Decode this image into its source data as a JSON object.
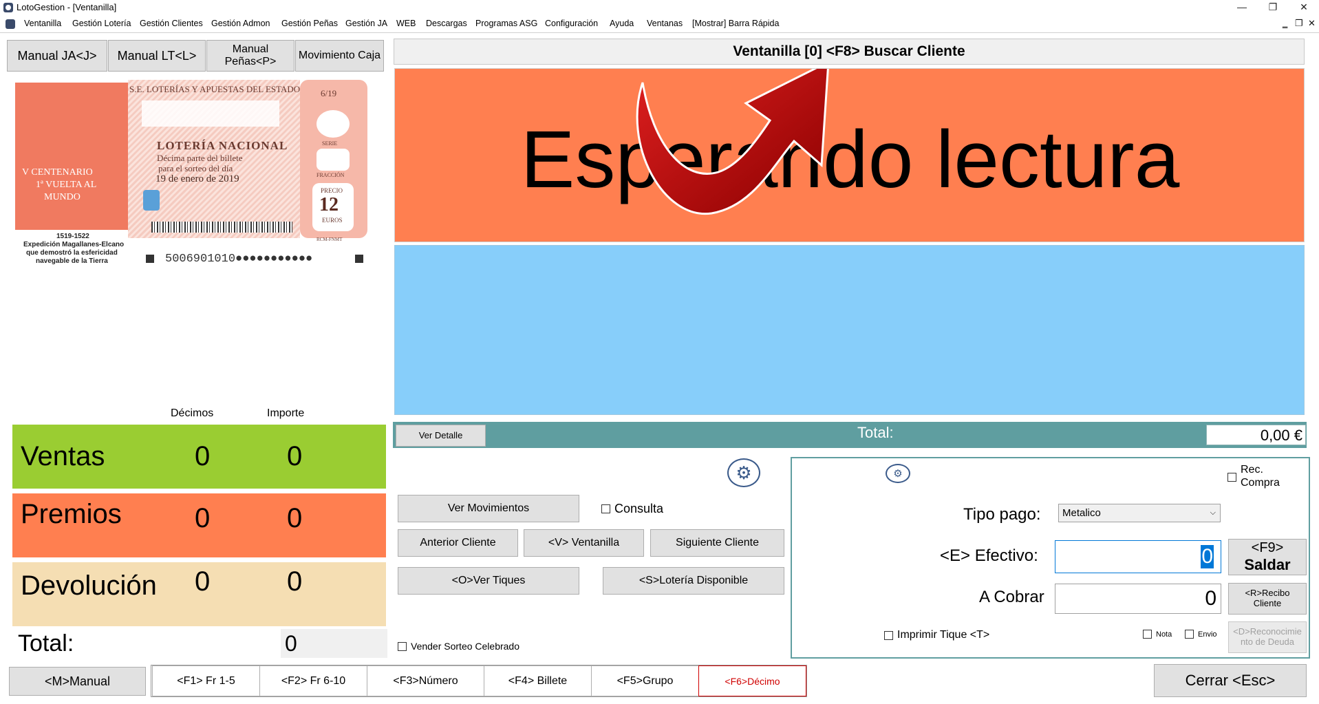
{
  "window": {
    "title": "LotoGestion - [Ventanilla]",
    "controls": [
      "—",
      "❐",
      "✕"
    ],
    "mdi_controls": [
      "‗",
      "❐",
      "✕"
    ]
  },
  "menu": [
    "Ventanilla",
    "Gestión Lotería",
    "Gestión Clientes",
    "Gestión Admon",
    "Gestión Peñas",
    "Gestión JA",
    "WEB",
    "Descargas",
    "Programas ASG",
    "Configuración",
    "Ayuda",
    "Ventanas",
    "[Mostrar] Barra Rápida"
  ],
  "top_buttons": {
    "manual_ja": "Manual JA<J>",
    "manual_lt": "Manual LT<L>",
    "manual_penas": "Manual Peñas<P>",
    "movimiento_caja": "Movimiento Caja"
  },
  "ticket": {
    "header": "S.E. LOTERÍAS Y APUESTAS DEL ESTADO",
    "number_badge": "6/19",
    "serie": "SERIE",
    "fraccion": "FRACCIÓN",
    "title": "LOTERÍA NACIONAL",
    "subtitle1": "Décima parte del billete",
    "subtitle2": "para el sorteo del día",
    "date": "19 de enero de 2019",
    "precio": "PRECIO",
    "price": "12",
    "euros": "EUROS",
    "left_text1": "V CENTENARIO",
    "left_text2": "1ª VUELTA AL",
    "left_text3": "MUNDO",
    "years": "1519-1522",
    "caption1": "Expedición Magallanes-Elcano",
    "caption2": "que demostró la esfericidad",
    "caption3": "navegable de la Tierra",
    "code": "5006901010●●●●●●●●●●●",
    "mint": "RCM-FNMT"
  },
  "stats": {
    "col_decimos": "Décimos",
    "col_importe": "Importe",
    "ventas": {
      "label": "Ventas",
      "decimos": "0",
      "importe": "0",
      "color": "#9acd32"
    },
    "premios": {
      "label": "Premios",
      "decimos": "0",
      "importe": "0",
      "color": "#ff7f50"
    },
    "devolucion": {
      "label": "Devolución",
      "decimos": "0",
      "importe": "0",
      "color": "#f5deb3"
    },
    "total_label": "Total:",
    "total_value": "0"
  },
  "main": {
    "header": "Ventanilla [0] <F8> Buscar Cliente",
    "status": "Esperando lectura",
    "ver_detalle": "Ver Detalle",
    "total_label": "Total:",
    "total_value": "0,00 €"
  },
  "actions": {
    "ver_movimientos": "Ver Movimientos",
    "consulta": "Consulta",
    "anterior_cliente": "Anterior Cliente",
    "ventanilla": "<V> Ventanilla",
    "siguiente_cliente": "Siguiente Cliente",
    "ver_tiques": "<O>Ver Tiques",
    "loteria_disponible": "<S>Lotería Disponible",
    "vender_sorteo": "Vender Sorteo Celebrado"
  },
  "payment": {
    "rec_compra_1": "Rec.",
    "rec_compra_2": "Compra",
    "tipo_pago_label": "Tipo pago:",
    "tipo_pago_value": "Metalico",
    "efectivo_label": "<E> Efectivo:",
    "efectivo_value": "0",
    "saldar_1": "<F9>",
    "saldar_2": "Saldar",
    "a_cobrar_label": "A Cobrar",
    "a_cobrar_value": "0",
    "recibo_1": "<R>Recibo",
    "recibo_2": "Cliente",
    "imprimir": "Imprimir Tique <T>",
    "nota": "Nota",
    "envio": "Envio",
    "reconocimiento_1": "<D>Reconocimie",
    "reconocimiento_2": "nto de Deuda"
  },
  "footer": {
    "manual": "<M>Manual",
    "f1": "<F1> Fr 1-5",
    "f2": "<F2> Fr 6-10",
    "f3": "<F3>Número",
    "f4": "<F4> Billete",
    "f5": "<F5>Grupo",
    "f6": "<F6>Décimo",
    "cerrar": "Cerrar <Esc>"
  },
  "colors": {
    "ventas": "#9acd32",
    "premios": "#ff7f50",
    "devolucion": "#f5deb3",
    "status_panel": "#ff7f50",
    "info_panel": "#87cefa",
    "total_bar": "#5f9ea0",
    "f6_text": "#d00000",
    "arrow": "#c00000"
  }
}
